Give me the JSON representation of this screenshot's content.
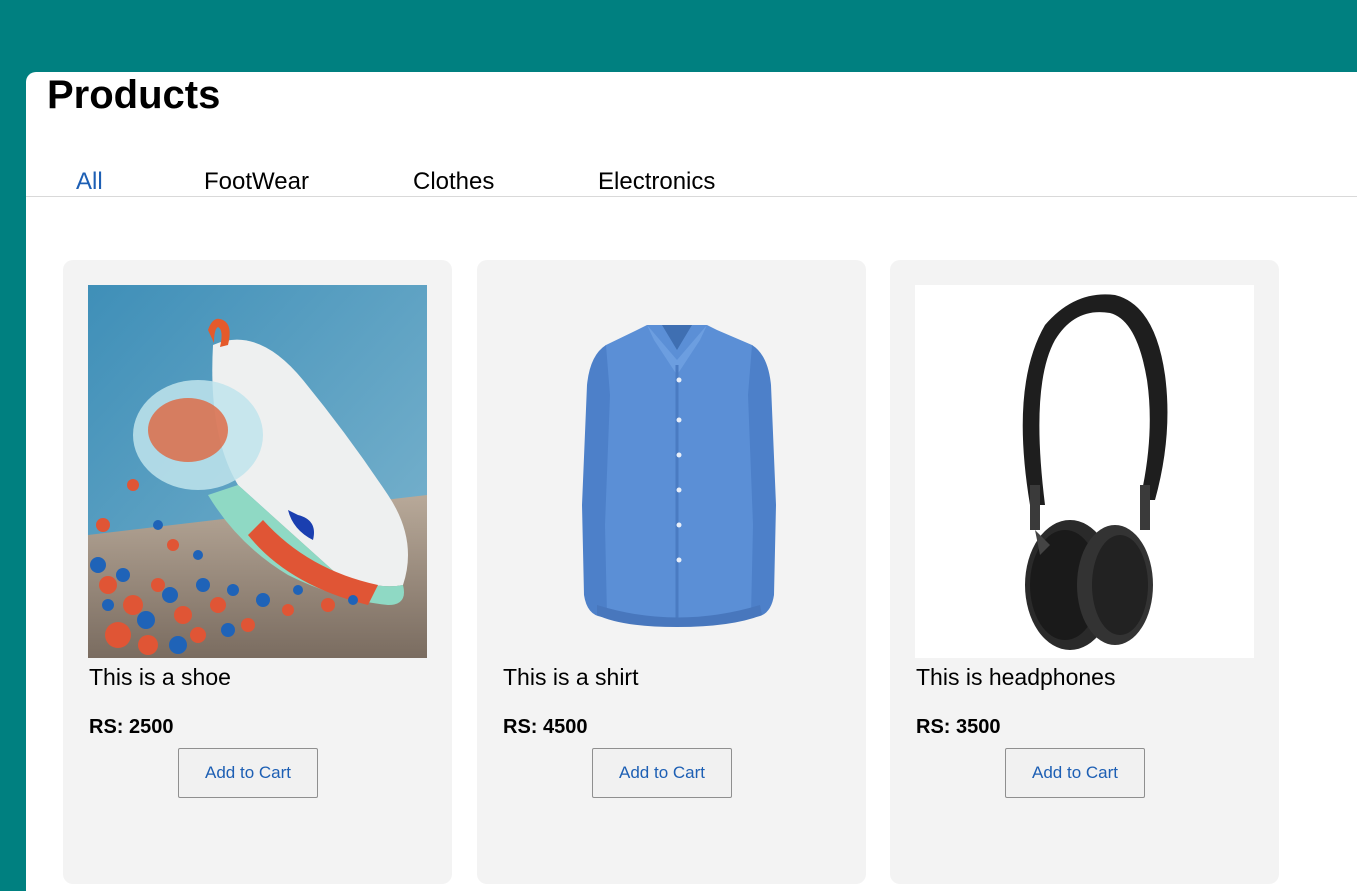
{
  "page": {
    "title": "Products"
  },
  "tabs": [
    {
      "label": "All",
      "active": true
    },
    {
      "label": "FootWear",
      "active": false
    },
    {
      "label": "Clothes",
      "active": false
    },
    {
      "label": "Electronics",
      "active": false
    }
  ],
  "products": [
    {
      "image": "shoe-image",
      "description": "This is a shoe",
      "price": "RS: 2500",
      "button": "Add to Cart"
    },
    {
      "image": "shirt-image",
      "description": "This is a shirt",
      "price": "RS: 4500",
      "button": "Add to Cart"
    },
    {
      "image": "headphones-image",
      "description": "This is headphones",
      "price": "RS: 3500",
      "button": "Add to Cart"
    }
  ],
  "colors": {
    "header_bg": "#008080",
    "tab_active": "#1d5fb4",
    "card_bg": "#f3f3f3",
    "button_text": "#1d5fb4"
  }
}
